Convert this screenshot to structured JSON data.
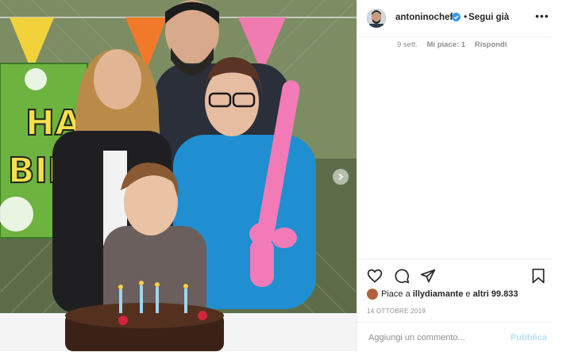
{
  "post": {
    "photo_alt": "Family photo with birthday cake",
    "banner_text": [
      "HA",
      "BIR"
    ]
  },
  "header": {
    "username": "antoninochef",
    "separator": "•",
    "follow_label": "Segui già",
    "more_label": "•••"
  },
  "comment": {
    "time": "9 sett.",
    "likes": "Mi piace: 1",
    "reply": "Rispondi"
  },
  "actions": {
    "like_icon": "heart-icon",
    "comment_icon": "comment-icon",
    "share_icon": "share-icon",
    "save_icon": "bookmark-icon"
  },
  "likes_line": {
    "prefix": "Piace a ",
    "user": "illydiamante",
    "middle": " e ",
    "others": "altri 99.833"
  },
  "date": "14 OTTOBRE 2019",
  "add_comment": {
    "placeholder": "Aggiungi un commento...",
    "publish": "Pubblica"
  },
  "colors": {
    "verified": "#3897f0",
    "publish_disabled": "#b2dffc",
    "border": "#efefef"
  }
}
